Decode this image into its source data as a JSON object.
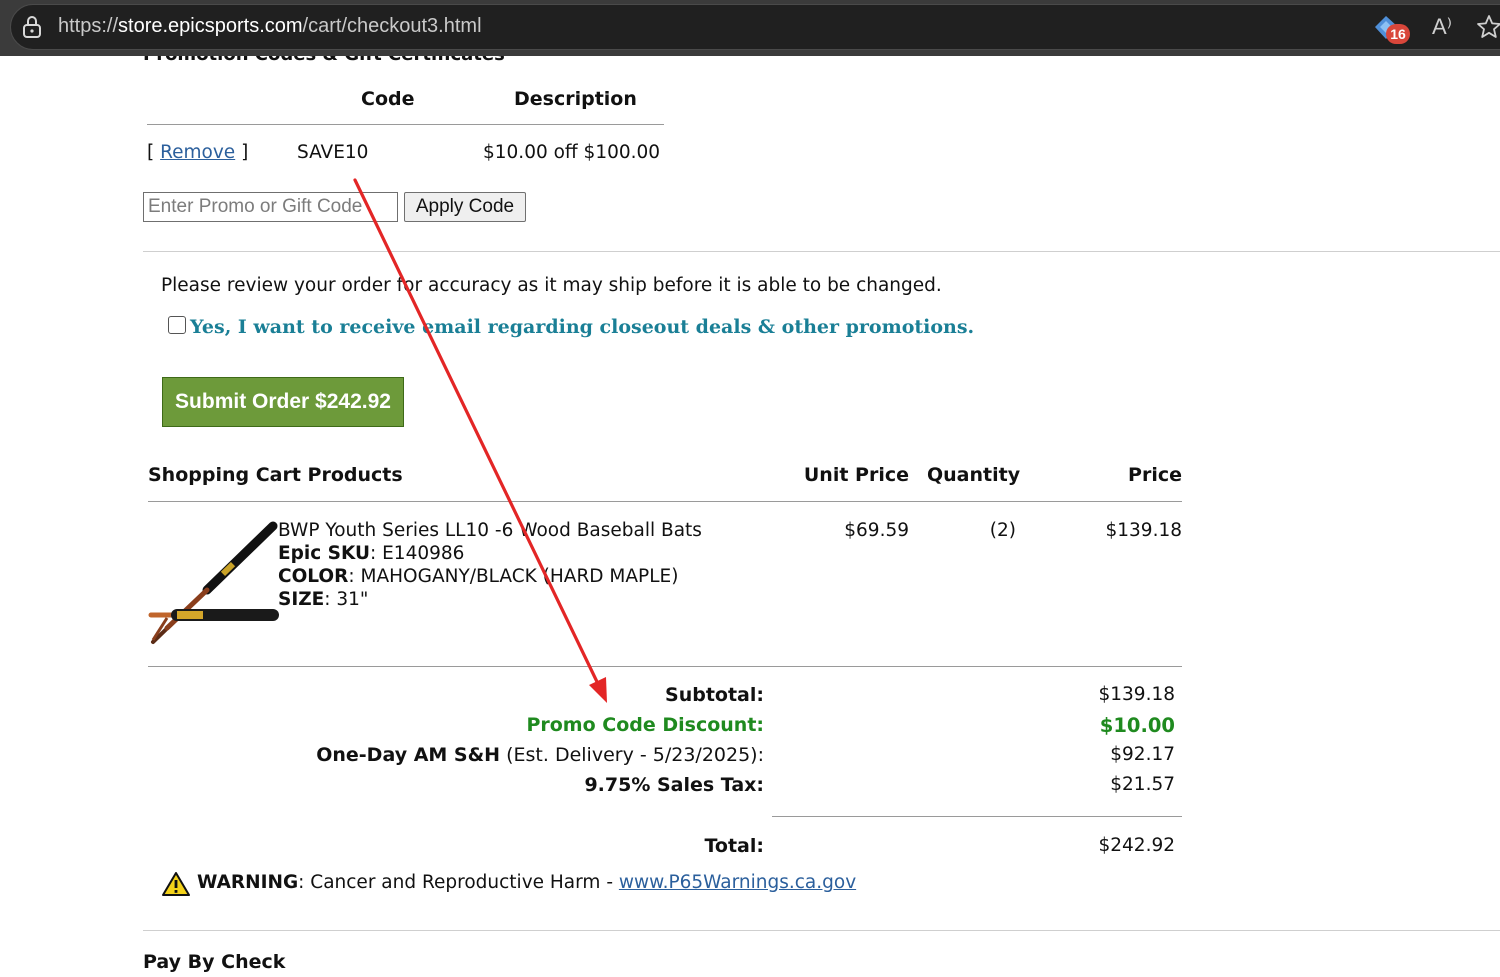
{
  "browser": {
    "url_prefix": "https://",
    "url_host": "store.epicsports.com",
    "url_path": "/cart/checkout3.html",
    "extension_badge": "16",
    "read_aloud_glyph": "A⁾"
  },
  "promo": {
    "section_heading": "Promotion Codes & Gift Certificates",
    "col_code": "Code",
    "col_description": "Description",
    "remove_open": "[ ",
    "remove_label": "Remove",
    "remove_close": " ]",
    "code": "SAVE10",
    "description": "$10.00 off $100.00",
    "input_placeholder": "Enter Promo or Gift Code",
    "apply_label": "Apply Code"
  },
  "review": {
    "notice": "Please review your order for accuracy as it may ship before it is able to be changed.",
    "optin_label": "Yes, I want to receive email regarding closeout deals & other promotions.",
    "submit_label": "Submit Order $242.92"
  },
  "cart": {
    "headers": {
      "products": "Shopping Cart Products",
      "unit_price": "Unit Price",
      "quantity": "Quantity",
      "price": "Price"
    },
    "item": {
      "name": "BWP Youth Series LL10 -6 Wood Baseball Bats",
      "sku_label": "Epic SKU",
      "sku": ": E140986",
      "color_label": "COLOR",
      "color": ": MAHOGANY/BLACK (HARD MAPLE)",
      "size_label": "SIZE",
      "size": ": 31\"",
      "unit_price": "$69.59",
      "quantity": "(2)",
      "price": "$139.18"
    }
  },
  "totals": {
    "subtotal_label": "Subtotal:",
    "subtotal": "$139.18",
    "discount_label": "Promo Code Discount:",
    "discount": "$10.00",
    "shipping_method": "One-Day AM S&H",
    "shipping_note": " (Est. Delivery - 5/23/2025):",
    "shipping": "$92.17",
    "tax_label": "9.75% Sales Tax:",
    "tax": "$21.57",
    "total_label": "Total:",
    "total": "$242.92"
  },
  "warning": {
    "label": "WARNING",
    "text": ": Cancer and Reproductive Harm - ",
    "link": "www.P65Warnings.ca.gov"
  },
  "payment": {
    "heading": "Pay By Check"
  },
  "colors": {
    "link": "#2b5f9c",
    "optin_teal": "#1a7f96",
    "submit_green": "#6d9a3a",
    "discount_green": "#1f8a1f",
    "annotation_arrow": "#e32626"
  }
}
